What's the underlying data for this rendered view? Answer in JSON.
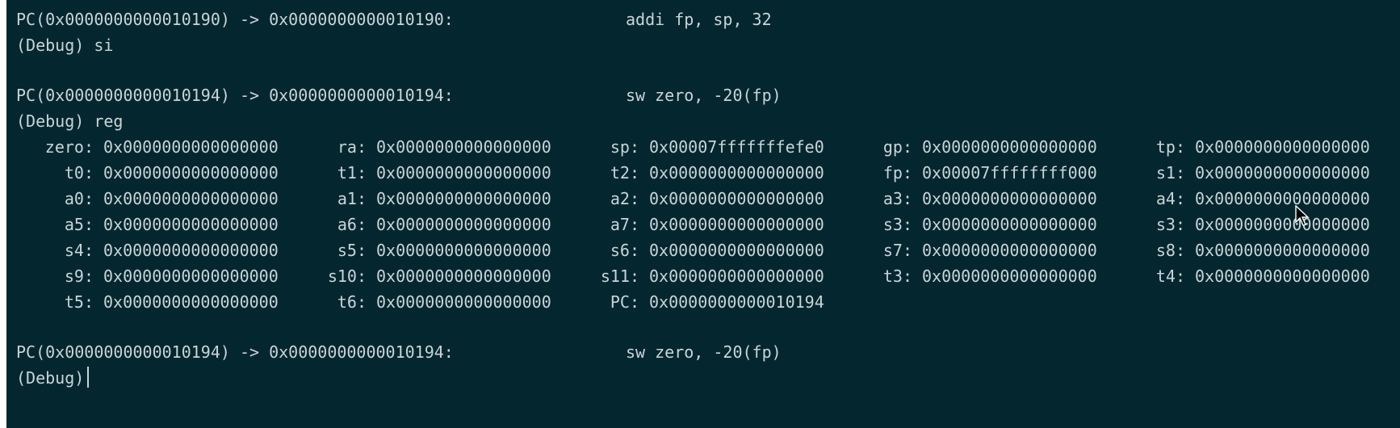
{
  "terminal": {
    "entries": [
      {
        "pc_left": "PC(0x0000000000010190) -> 0x0000000000010190:",
        "instr": "addi fp, sp, 32"
      },
      {
        "prompt": "(Debug) si"
      },
      {
        "pc_left": "PC(0x0000000000010194) -> 0x0000000000010194:",
        "instr": "sw zero, -20(fp)"
      },
      {
        "prompt": "(Debug) reg"
      },
      {
        "pc_left": "PC(0x0000000000010194) -> 0x0000000000010194:",
        "instr": "sw zero, -20(fp)"
      },
      {
        "prompt": "(Debug)"
      }
    ],
    "registers": [
      {
        "name": "zero:",
        "value": "0x0000000000000000"
      },
      {
        "name": "ra:",
        "value": "0x0000000000000000"
      },
      {
        "name": "sp:",
        "value": "0x00007fffffffefe0"
      },
      {
        "name": "gp:",
        "value": "0x0000000000000000"
      },
      {
        "name": "tp:",
        "value": "0x0000000000000000"
      },
      {
        "name": "t0:",
        "value": "0x0000000000000000"
      },
      {
        "name": "t1:",
        "value": "0x0000000000000000"
      },
      {
        "name": "t2:",
        "value": "0x0000000000000000"
      },
      {
        "name": "fp:",
        "value": "0x00007ffffffff000"
      },
      {
        "name": "s1:",
        "value": "0x0000000000000000"
      },
      {
        "name": "a0:",
        "value": "0x0000000000000000"
      },
      {
        "name": "a1:",
        "value": "0x0000000000000000"
      },
      {
        "name": "a2:",
        "value": "0x0000000000000000"
      },
      {
        "name": "a3:",
        "value": "0x0000000000000000"
      },
      {
        "name": "a4:",
        "value": "0x0000000000000000"
      },
      {
        "name": "a5:",
        "value": "0x0000000000000000"
      },
      {
        "name": "a6:",
        "value": "0x0000000000000000"
      },
      {
        "name": "a7:",
        "value": "0x0000000000000000"
      },
      {
        "name": "s3:",
        "value": "0x0000000000000000"
      },
      {
        "name": "s3:",
        "value": "0x0000000000000000"
      },
      {
        "name": "s4:",
        "value": "0x0000000000000000"
      },
      {
        "name": "s5:",
        "value": "0x0000000000000000"
      },
      {
        "name": "s6:",
        "value": "0x0000000000000000"
      },
      {
        "name": "s7:",
        "value": "0x0000000000000000"
      },
      {
        "name": "s8:",
        "value": "0x0000000000000000"
      },
      {
        "name": "s9:",
        "value": "0x0000000000000000"
      },
      {
        "name": "s10:",
        "value": "0x0000000000000000"
      },
      {
        "name": "s11:",
        "value": "0x0000000000000000"
      },
      {
        "name": "t3:",
        "value": "0x0000000000000000"
      },
      {
        "name": "t4:",
        "value": "0x0000000000000000"
      },
      {
        "name": "t5:",
        "value": "0x0000000000000000"
      },
      {
        "name": "t6:",
        "value": "0x0000000000000000"
      },
      {
        "name": "PC:",
        "value": "0x0000000000010194"
      }
    ]
  },
  "colors": {
    "background": "#04272f",
    "text": "#c9d4d8"
  },
  "icons": {
    "mouse_pointer": "mouse-pointer-icon"
  }
}
